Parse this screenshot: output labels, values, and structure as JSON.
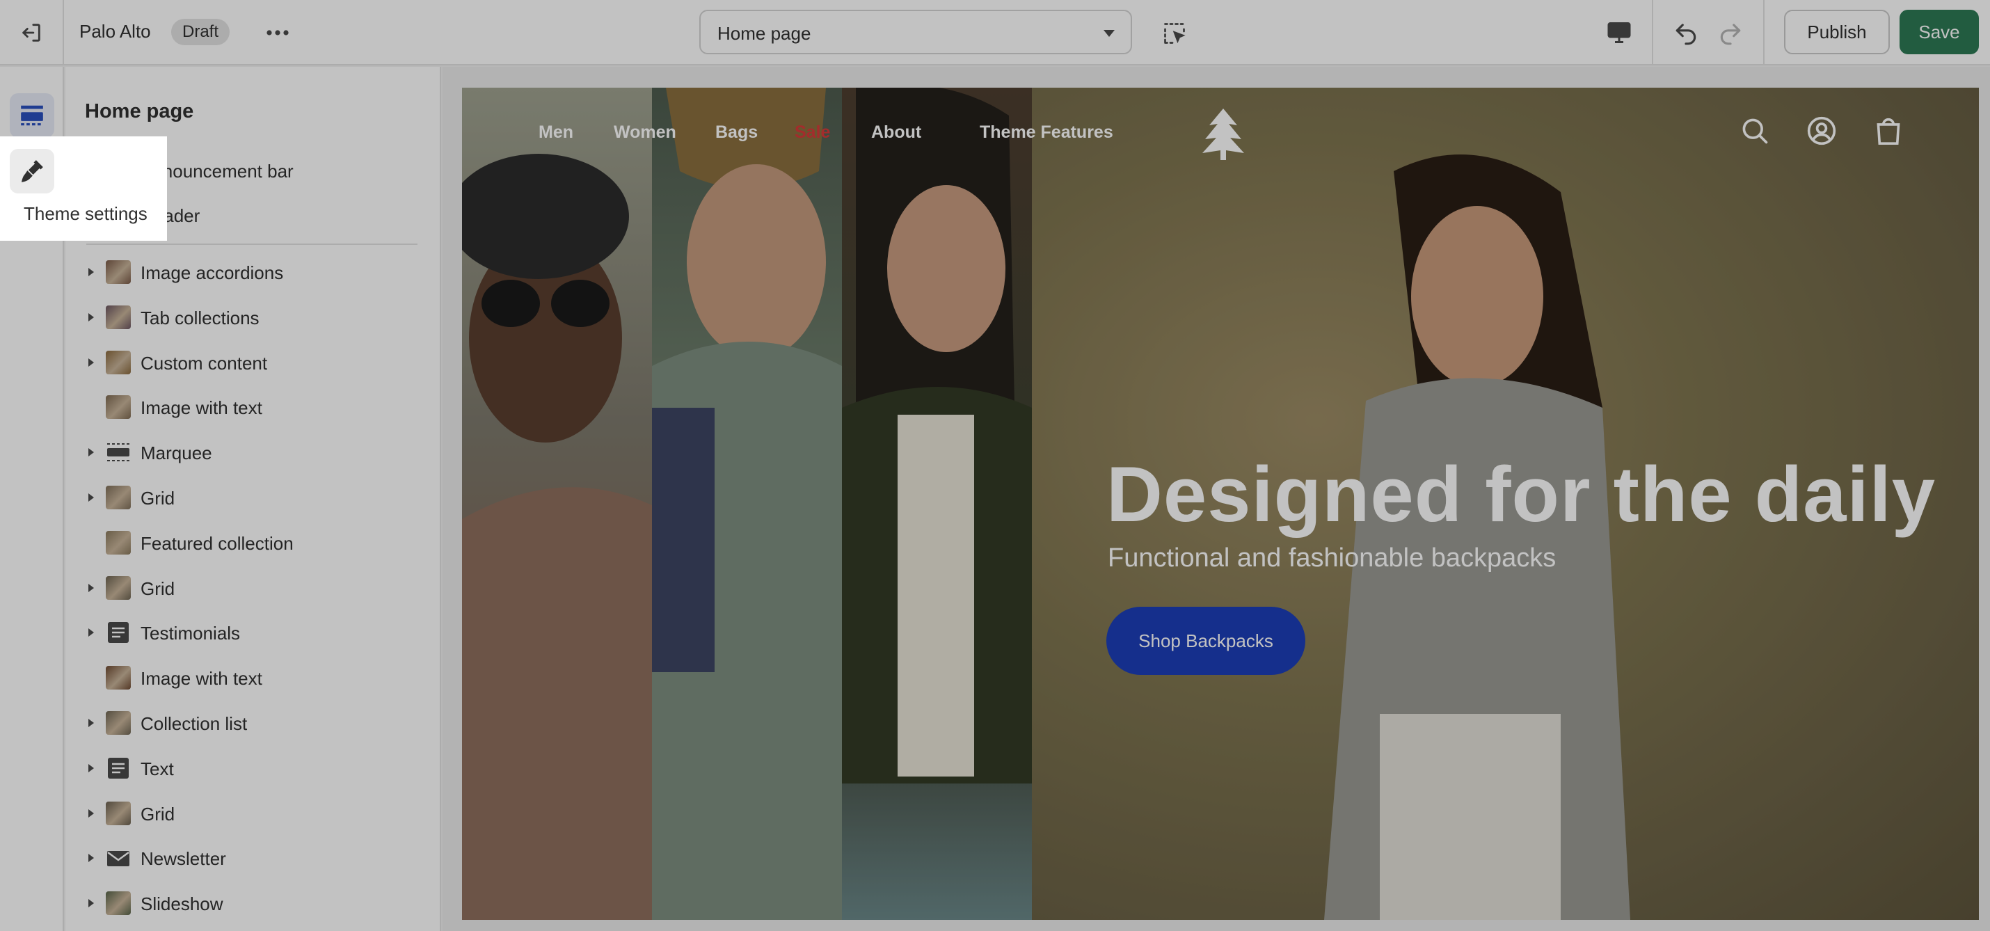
{
  "topbar": {
    "store_name": "Palo Alto",
    "status_badge": "Draft",
    "page_selector": "Home page",
    "publish_label": "Publish",
    "save_label": "Save",
    "icons": [
      "exit-icon",
      "more-horizontal-icon",
      "select-arrow-icon",
      "inspector-icon",
      "desktop-icon",
      "undo-icon",
      "redo-icon"
    ]
  },
  "rail": {
    "items": [
      "sections-icon",
      "theme-settings-icon",
      "apps-icon"
    ],
    "tooltip": "Theme settings"
  },
  "panel": {
    "title": "Home page",
    "header_group": [
      {
        "label": "Announcement bar",
        "expandable": true,
        "icon": "announcement-icon"
      },
      {
        "label": "Header",
        "expandable": true,
        "icon": "header-icon"
      }
    ],
    "sections": [
      {
        "label": "Image accordions",
        "expandable": true
      },
      {
        "label": "Tab collections",
        "expandable": true
      },
      {
        "label": "Custom content",
        "expandable": true
      },
      {
        "label": "Image with text",
        "expandable": false
      },
      {
        "label": "Marquee",
        "expandable": true
      },
      {
        "label": "Grid",
        "expandable": true
      },
      {
        "label": "Featured collection",
        "expandable": false
      },
      {
        "label": "Grid",
        "expandable": true
      },
      {
        "label": "Testimonials",
        "expandable": true
      },
      {
        "label": "Image with text",
        "expandable": false
      },
      {
        "label": "Collection list",
        "expandable": true
      },
      {
        "label": "Text",
        "expandable": true
      },
      {
        "label": "Grid",
        "expandable": true
      },
      {
        "label": "Newsletter",
        "expandable": true
      },
      {
        "label": "Slideshow",
        "expandable": true
      }
    ]
  },
  "preview": {
    "nav": [
      "Men",
      "Women",
      "Bags",
      "Sale",
      "About",
      "Theme Features"
    ],
    "sale_color": "#d63a3a",
    "title": "Designed for the daily",
    "subtitle": "Functional and fashionable backpacks",
    "cta": "Shop Backpacks",
    "cta_color": "#1c3fb8",
    "header_icons": [
      "search-icon",
      "account-icon",
      "cart-icon"
    ]
  },
  "colors": {
    "accent": "#2d7a55",
    "overlay": "rgba(0,0,0,0.24)"
  }
}
